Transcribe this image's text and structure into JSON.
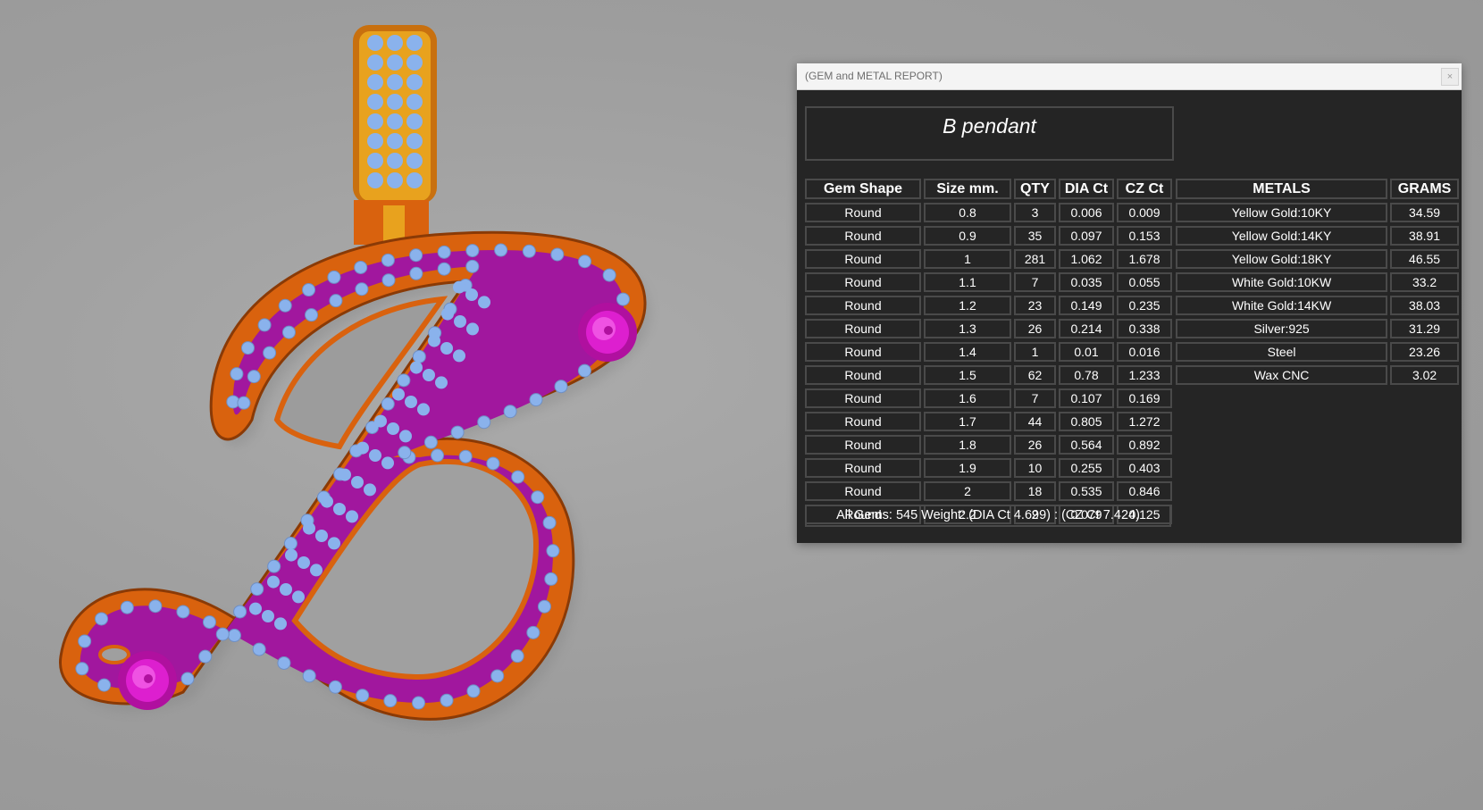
{
  "window": {
    "title": "(GEM and METAL REPORT)",
    "close_label": "×"
  },
  "report": {
    "name": "B pendant",
    "gem_headers": [
      "Gem Shape",
      "Size mm.",
      "QTY",
      "DIA Ct",
      "CZ Ct"
    ],
    "gems": [
      [
        "Round",
        "0.8",
        "3",
        "0.006",
        "0.009"
      ],
      [
        "Round",
        "0.9",
        "35",
        "0.097",
        "0.153"
      ],
      [
        "Round",
        "1",
        "281",
        "1.062",
        "1.678"
      ],
      [
        "Round",
        "1.1",
        "7",
        "0.035",
        "0.055"
      ],
      [
        "Round",
        "1.2",
        "23",
        "0.149",
        "0.235"
      ],
      [
        "Round",
        "1.3",
        "26",
        "0.214",
        "0.338"
      ],
      [
        "Round",
        "1.4",
        "1",
        "0.01",
        "0.016"
      ],
      [
        "Round",
        "1.5",
        "62",
        "0.78",
        "1.233"
      ],
      [
        "Round",
        "1.6",
        "7",
        "0.107",
        "0.169"
      ],
      [
        "Round",
        "1.7",
        "44",
        "0.805",
        "1.272"
      ],
      [
        "Round",
        "1.8",
        "26",
        "0.564",
        "0.892"
      ],
      [
        "Round",
        "1.9",
        "10",
        "0.255",
        "0.403"
      ],
      [
        "Round",
        "2",
        "18",
        "0.535",
        "0.846"
      ],
      [
        "Round",
        "2.2",
        "2",
        "0.079",
        "0.125"
      ]
    ],
    "metal_headers": [
      "METALS",
      "GRAMS"
    ],
    "metals": [
      [
        "Yellow Gold:10KY",
        "34.59"
      ],
      [
        "Yellow Gold:14KY",
        "38.91"
      ],
      [
        "Yellow Gold:18KY",
        "46.55"
      ],
      [
        "White Gold:10KW",
        "33.2"
      ],
      [
        "White Gold:14KW",
        "38.03"
      ],
      [
        "Silver:925",
        "31.29"
      ],
      [
        "Steel",
        "23.26"
      ],
      [
        "Wax  CNC",
        "3.02"
      ]
    ],
    "total": "All Gems: 545  Weight: (DIA Ct 4.699) : (CZ Ct 7.424)"
  },
  "colors": {
    "background": "#a3a3a3",
    "metal_orange": "#d9620e",
    "bail_gold": "#e8a21e",
    "setting_magenta": "#a1179e",
    "gem_blue": "#8ab2ec",
    "rose_pink": "#dd1fcf",
    "panel": "#252525",
    "cell_border": "#4a4a4a"
  }
}
